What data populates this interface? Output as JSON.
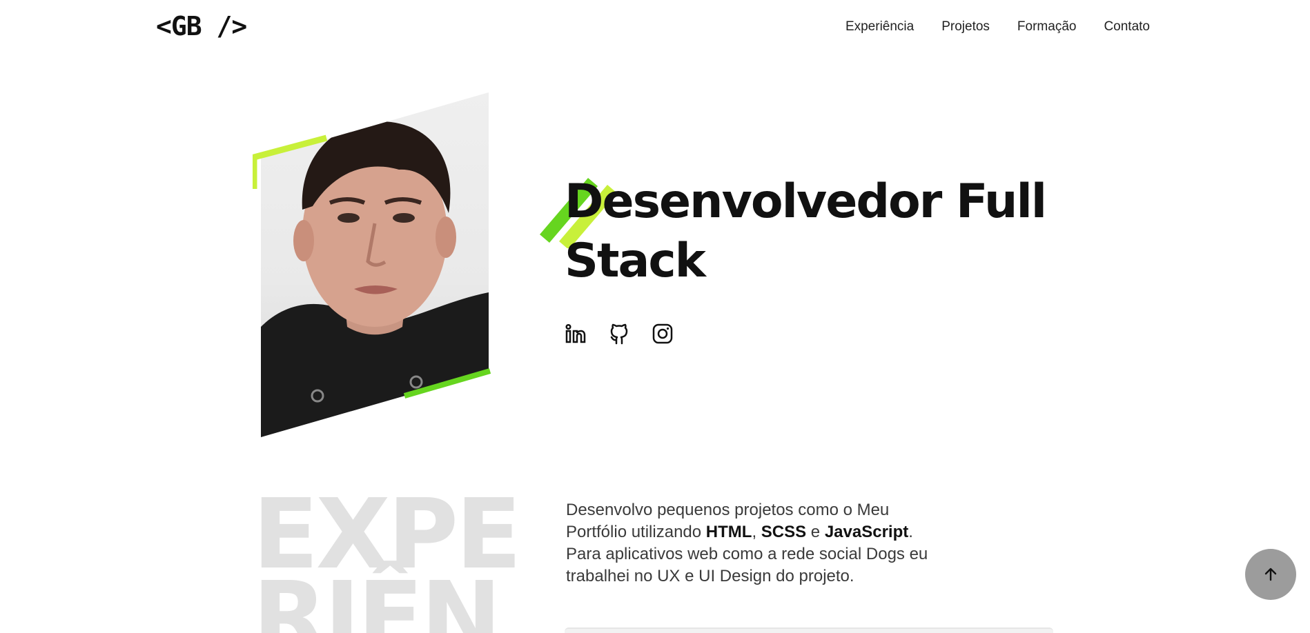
{
  "header": {
    "logo": "<GB />",
    "nav": [
      "Experiência",
      "Projetos",
      "Formação",
      "Contato"
    ]
  },
  "hero": {
    "title_line1": "Desenvolvedor Full",
    "title_line2": "Stack",
    "socials": [
      "linkedin-icon",
      "github-icon",
      "instagram-icon"
    ]
  },
  "section": {
    "bigword_line1": "EXPE",
    "bigword_line2": "RIÊN",
    "description": {
      "part1": "Desenvolvo pequenos projetos como o Meu Portfólio utilizando ",
      "html": "HTML",
      "comma": ", ",
      "scss": "SCSS",
      "and": " e ",
      "js": "JavaScript",
      "part2": ". Para aplicativos web como a rede social Dogs eu trabalhei no UX e UI Design do projeto."
    }
  },
  "colors": {
    "accent_light": "#c8f03a",
    "accent_green": "#66d51f",
    "text": "#111111",
    "muted_bigword": "#e1e1e1",
    "totop_bg": "#9c9c9c"
  },
  "icons": {
    "back_to_top": "arrow-up-icon"
  }
}
